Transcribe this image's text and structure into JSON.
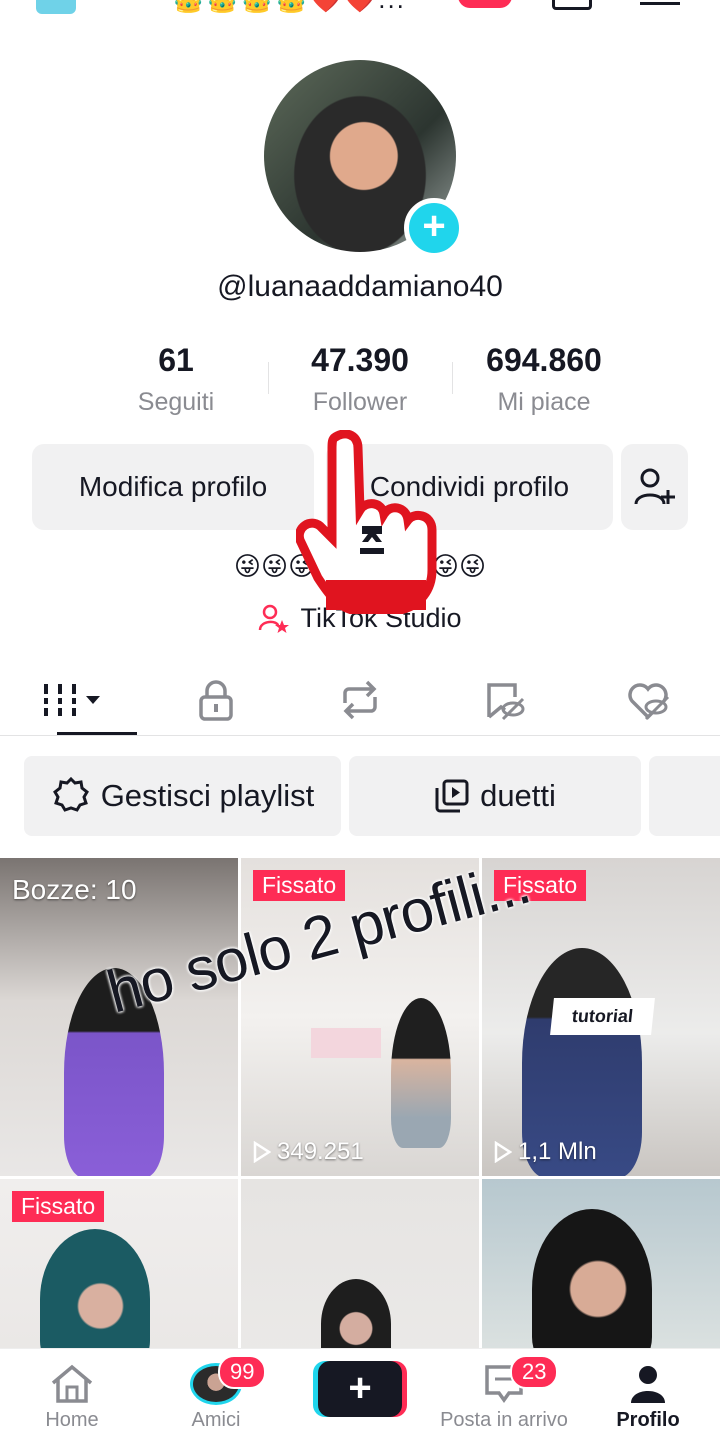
{
  "top_bar": {
    "badges": "👑👑👑👑❤️❤️..."
  },
  "profile": {
    "username": "@luanaaddamiano40",
    "stats": [
      {
        "value": "61",
        "label": "Seguiti"
      },
      {
        "value": "47.390",
        "label": "Follower"
      },
      {
        "value": "694.860",
        "label": "Mi piace"
      }
    ],
    "edit_label": "Modifica profilo",
    "share_label": "Condividi profilo",
    "bio": "😜😜😜IRONIA😜😜😜",
    "studio_label": "TikTok Studio"
  },
  "playlists": {
    "manage_label": "Gestisci playlist",
    "duet_label": "duetti"
  },
  "videos": {
    "drafts_label": "Bozze: 10",
    "pinned_label": "Fissato",
    "tile2_views": "349.251",
    "tile3_views": "1,1 Mln",
    "tile3_sticker": "tutorial",
    "overlay_caption": "ho solo 2 profili..."
  },
  "nav": {
    "home": "Home",
    "friends": "Amici",
    "friends_badge": "99",
    "inbox": "Posta in arrivo",
    "inbox_badge": "23",
    "profile": "Profilo"
  }
}
